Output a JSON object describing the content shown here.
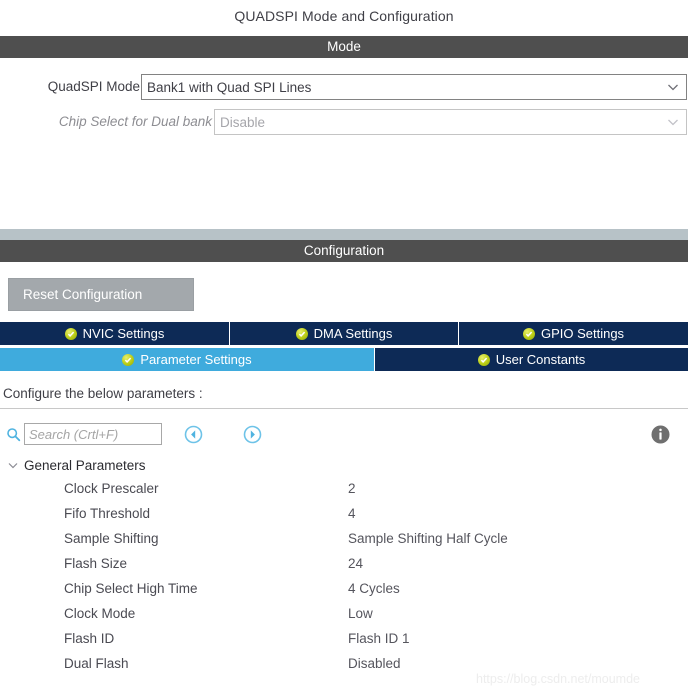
{
  "page": {
    "title": "QUADSPI Mode and Configuration",
    "watermark": "https://blog.csdn.net/moumde"
  },
  "mode_section": {
    "header": "Mode",
    "fields": [
      {
        "label": "QuadSPI Mode",
        "value": "Bank1 with Quad SPI Lines",
        "disabled": false
      },
      {
        "label": "Chip Select for Dual bank",
        "value": "Disable",
        "disabled": true
      }
    ]
  },
  "configuration_section": {
    "header": "Configuration",
    "reset_button": "Reset Configuration",
    "tabs_row1": [
      {
        "label": "NVIC Settings",
        "active": false,
        "icon": "check-circle-icon"
      },
      {
        "label": "DMA Settings",
        "active": false,
        "icon": "check-circle-icon"
      },
      {
        "label": "GPIO Settings",
        "active": false,
        "icon": "check-circle-icon"
      }
    ],
    "tabs_row2": [
      {
        "label": "Parameter Settings",
        "active": true,
        "icon": "check-circle-icon"
      },
      {
        "label": "User Constants",
        "active": false,
        "icon": "check-circle-icon"
      }
    ],
    "configure_label": "Configure the below parameters :",
    "search": {
      "placeholder": "Search (Crtl+F)",
      "value": "",
      "icon": "search-icon"
    },
    "toolbar_icons": {
      "prev": "circle-left-arrow-icon",
      "next": "circle-right-arrow-icon",
      "info": "info-circle-icon"
    },
    "parameter_group": {
      "label": "General Parameters",
      "expanded": true,
      "parameters": [
        {
          "name": "Clock Prescaler",
          "value": "2"
        },
        {
          "name": "Fifo Threshold",
          "value": "4"
        },
        {
          "name": "Sample Shifting",
          "value": "Sample Shifting Half Cycle"
        },
        {
          "name": "Flash Size",
          "value": "24"
        },
        {
          "name": "Chip Select High Time",
          "value": "4 Cycles"
        },
        {
          "name": "Clock Mode",
          "value": "Low"
        },
        {
          "name": "Flash ID",
          "value": "Flash ID 1"
        },
        {
          "name": "Dual Flash",
          "value": "Disabled"
        }
      ]
    }
  },
  "colors": {
    "section_bar": "#4f4f4f",
    "tab_inactive": "#0d2a56",
    "tab_active": "#3fabdd",
    "reset_button": "#a3a8ac",
    "accent_blue": "#3fabdd",
    "band": "#b7c2c7"
  }
}
